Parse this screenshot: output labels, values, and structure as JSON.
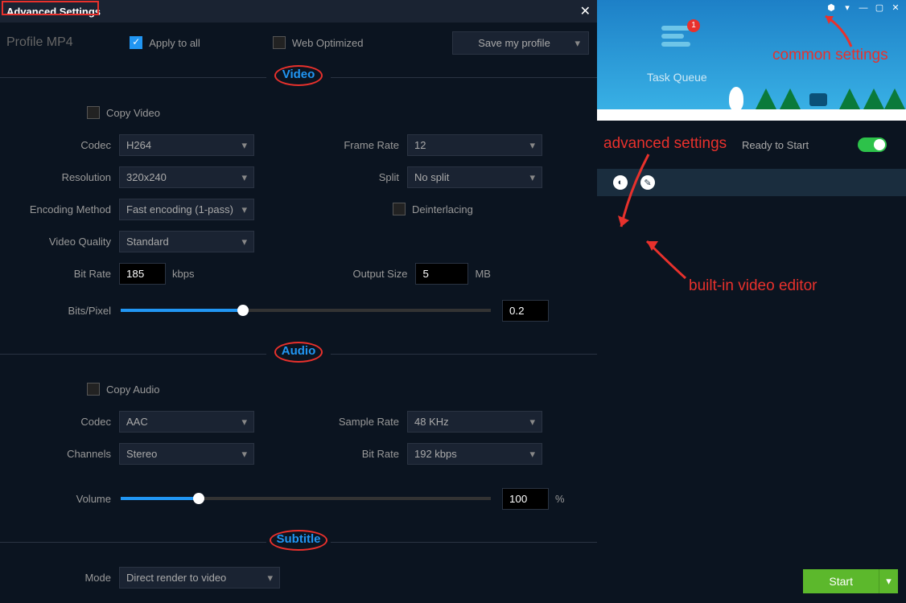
{
  "title": "Advanced Settings",
  "profile": {
    "label": "Profile  MP4",
    "apply_all": "Apply to all",
    "web_opt": "Web Optimized",
    "save_profile": "Save my profile"
  },
  "sections": {
    "video": "Video",
    "audio": "Audio",
    "subtitle": "Subtitle"
  },
  "video": {
    "copy": "Copy Video",
    "codec_label": "Codec",
    "codec": "H264",
    "frame_rate_label": "Frame Rate",
    "frame_rate": "12",
    "resolution_label": "Resolution",
    "resolution": "320x240",
    "split_label": "Split",
    "split": "No split",
    "encoding_label": "Encoding Method",
    "encoding": "Fast encoding (1-pass)",
    "deint": "Deinterlacing",
    "quality_label": "Video Quality",
    "quality": "Standard",
    "bitrate_label": "Bit Rate",
    "bitrate": "185",
    "bitrate_unit": "kbps",
    "output_label": "Output Size",
    "output": "5",
    "output_unit": "MB",
    "bpp_label": "Bits/Pixel",
    "bpp": "0.2"
  },
  "audio": {
    "copy": "Copy Audio",
    "codec_label": "Codec",
    "codec": "AAC",
    "sample_label": "Sample Rate",
    "sample": "48 KHz",
    "channels_label": "Channels",
    "channels": "Stereo",
    "bitrate_label": "Bit Rate",
    "bitrate": "192 kbps",
    "volume_label": "Volume",
    "volume": "100",
    "volume_unit": "%"
  },
  "subtitle": {
    "mode_label": "Mode",
    "mode": "Direct render to video"
  },
  "right": {
    "task_queue": "Task Queue",
    "badge": "1",
    "ready": "Ready to Start",
    "start": "Start"
  },
  "anno": {
    "common": "common settings",
    "advanced": "advanced settings",
    "editor": "built-in video editor"
  }
}
